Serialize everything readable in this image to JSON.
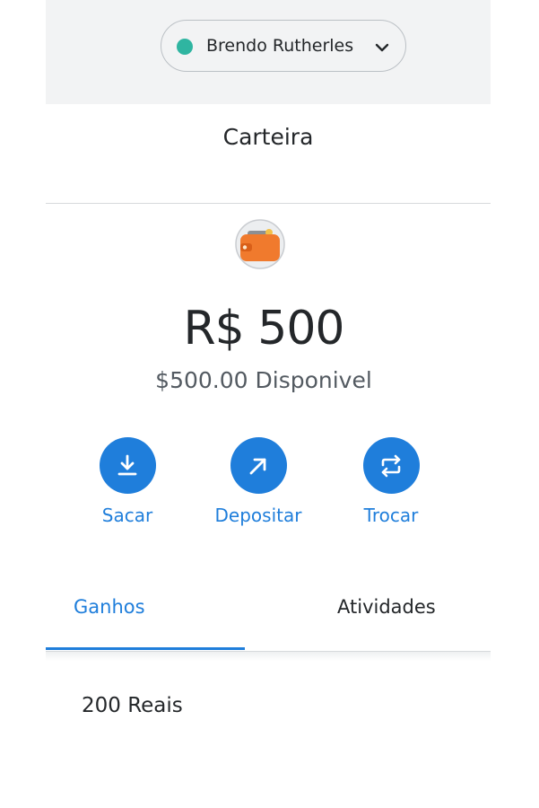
{
  "header": {
    "account_name": "Brendo Rutherles",
    "account_dot_color": "#2fb5a1",
    "chevron_icon": "chevron-down-icon"
  },
  "title": "Carteira",
  "wallet": {
    "icon": "wallet-icon",
    "balance_primary": "R$ 500",
    "balance_secondary": "$500.00 Disponivel"
  },
  "actions": [
    {
      "label": "Sacar",
      "icon": "download-icon"
    },
    {
      "label": "Depositar",
      "icon": "arrow-up-right-icon"
    },
    {
      "label": "Trocar",
      "icon": "swap-icon"
    }
  ],
  "tabs": [
    {
      "label": "Ganhos",
      "active": true
    },
    {
      "label": "Atividades",
      "active": false
    }
  ],
  "earnings": [
    {
      "text": "200 Reais"
    }
  ],
  "colors": {
    "accent": "#1f7edb",
    "header_bg": "#f2f3f4",
    "text": "#24272a"
  }
}
